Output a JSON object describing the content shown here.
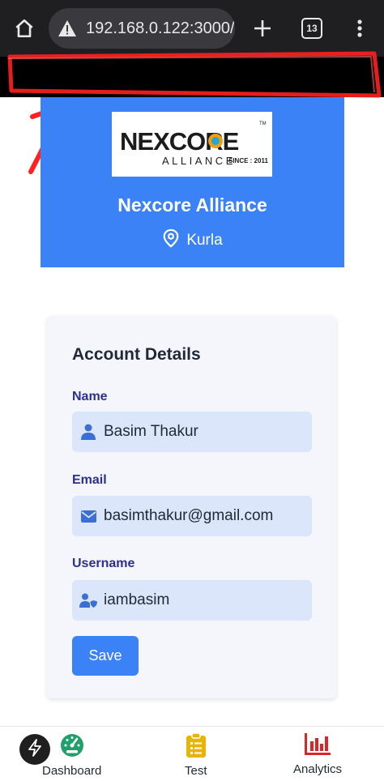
{
  "browser": {
    "url": "192.168.0.122:3000/",
    "tab_count": "13"
  },
  "hero": {
    "company_name": "Nexcore Alliance",
    "location": "Kurla",
    "logo": {
      "line1": "NEXCORE",
      "line2": "ALLIANCE",
      "since": "SINCE : 2011",
      "tm": "TM"
    }
  },
  "account": {
    "title": "Account Details",
    "fields": [
      {
        "label": "Name",
        "value": "Basim Thakur",
        "icon": "user-icon"
      },
      {
        "label": "Email",
        "value": "basimthakur@gmail.com",
        "icon": "envelope-icon"
      },
      {
        "label": "Username",
        "value": "iambasim",
        "icon": "user-shield-icon"
      }
    ],
    "save_label": "Save"
  },
  "nav": {
    "items": [
      {
        "label": "Dashboard",
        "icon": "gauge-icon"
      },
      {
        "label": "Test",
        "icon": "clipboard-list-icon"
      },
      {
        "label": "Analytics",
        "icon": "bar-chart-icon"
      }
    ]
  },
  "colors": {
    "primary": "#3b82f6",
    "field_bg": "#dbe6fb",
    "label": "#2d2f8e",
    "annotation": "#ff2020"
  }
}
